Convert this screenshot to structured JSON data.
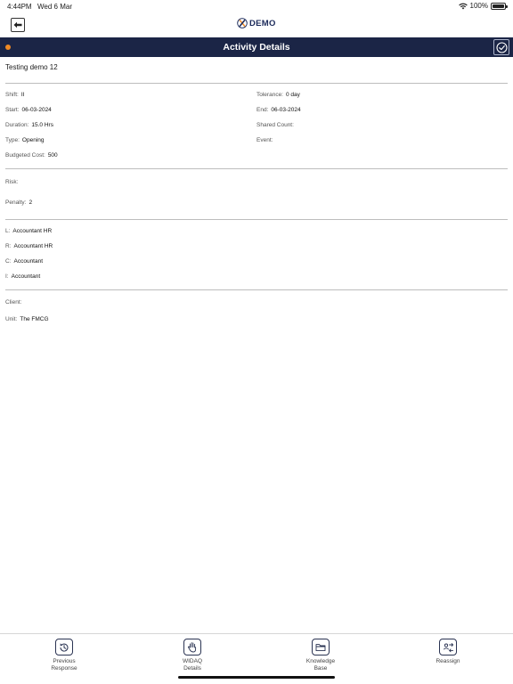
{
  "status_bar": {
    "time": "4:44PM",
    "date": "Wed 6 Mar",
    "battery": "100%"
  },
  "app": {
    "logo_mark": "X",
    "logo_text": "DEMO"
  },
  "header": {
    "title": "Activity Details",
    "accent_color": "#f08a24",
    "bar_color": "#1b2546"
  },
  "activity": {
    "title": "Testing demo 12"
  },
  "details": {
    "shift": {
      "label": "Shift:",
      "value": "II"
    },
    "tolerance": {
      "label": "Tolerance:",
      "value": "0 day"
    },
    "start": {
      "label": "Start:",
      "value": "06-03-2024"
    },
    "end": {
      "label": "End:",
      "value": "06-03-2024"
    },
    "duration": {
      "label": "Duration:",
      "value": "15.0 Hrs"
    },
    "shared_count": {
      "label": "Shared Count:",
      "value": ""
    },
    "type": {
      "label": "Type:",
      "value": "Opening"
    },
    "event": {
      "label": "Event:",
      "value": ""
    },
    "budgeted_cost": {
      "label": "Budgeted Cost:",
      "value": "500"
    }
  },
  "risk": {
    "risk": {
      "label": "Risk:",
      "value": ""
    },
    "penalty": {
      "label": "Penalty:",
      "value": "2"
    }
  },
  "responsibility": {
    "l": {
      "label": "L:",
      "value": "Accountant HR"
    },
    "r": {
      "label": "R:",
      "value": "Accountant HR"
    },
    "c": {
      "label": "C:",
      "value": "Accountant"
    },
    "i": {
      "label": "I:",
      "value": "Accountant"
    }
  },
  "client": {
    "client": {
      "label": "Client:",
      "value": ""
    },
    "unit": {
      "label": "Unit:",
      "value": "The FMCG"
    }
  },
  "bottom_tabs": [
    {
      "label_line1": "Previous",
      "label_line2": "Response",
      "icon": "clock-history-icon"
    },
    {
      "label_line1": "WIDAQ",
      "label_line2": "Details",
      "icon": "hand-icon"
    },
    {
      "label_line1": "Knowledge",
      "label_line2": "Base",
      "icon": "folder-icon"
    },
    {
      "label_line1": "Reassign",
      "label_line2": "",
      "icon": "reassign-icon"
    }
  ]
}
